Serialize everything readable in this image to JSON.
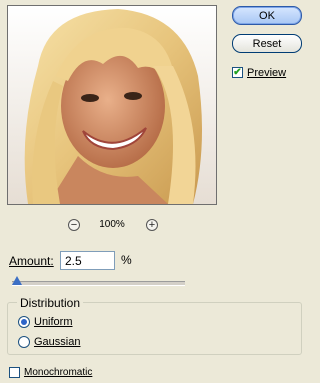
{
  "preview": {
    "zoom_out_symbol": "−",
    "zoom_in_symbol": "+",
    "zoom_level": "100%"
  },
  "buttons": {
    "ok_label": "OK",
    "reset_label": "Reset"
  },
  "preview_toggle": {
    "label": "Preview",
    "checked": true
  },
  "amount": {
    "label": "Amount:",
    "value": "2.5",
    "unit": "%"
  },
  "slider": {
    "value_fraction": 0.0
  },
  "distribution": {
    "legend": "Distribution",
    "options": [
      {
        "label": "Uniform",
        "selected": true
      },
      {
        "label": "Gaussian",
        "selected": false
      }
    ]
  },
  "monochromatic": {
    "label": "Monochromatic",
    "checked": false
  },
  "colors": {
    "accent": "#2d64c8",
    "dialog_bg": "#ece9d8"
  }
}
